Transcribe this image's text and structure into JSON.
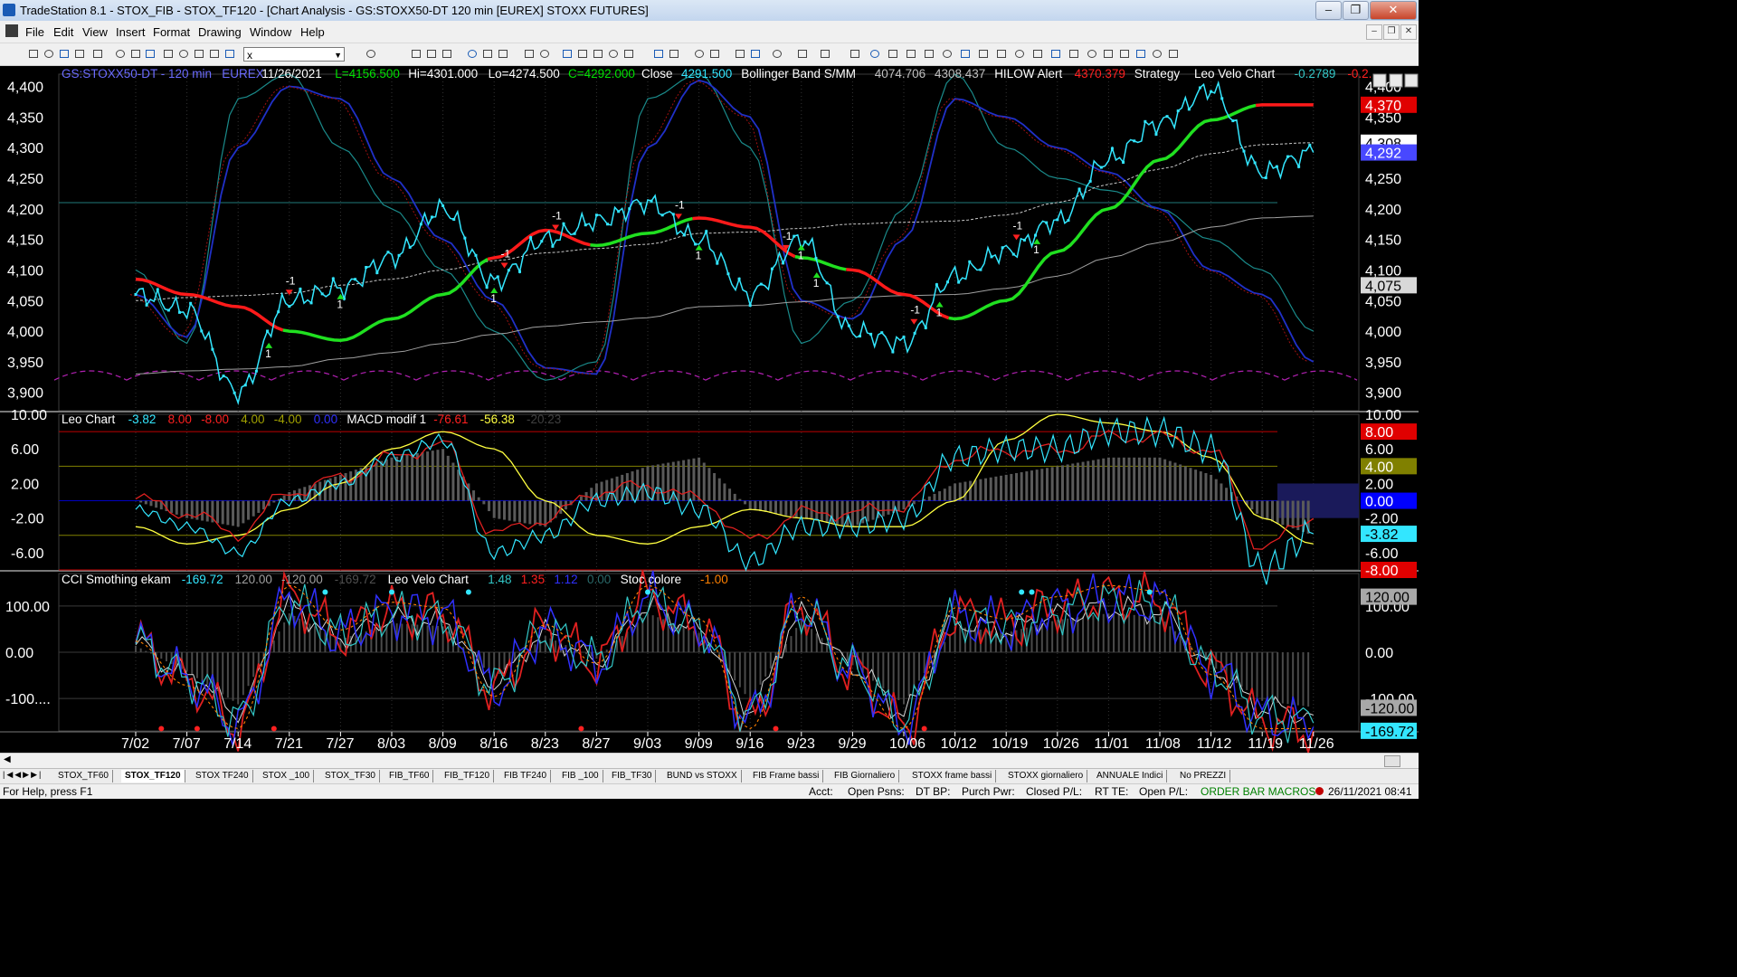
{
  "window": {
    "title": "TradeStation 8.1 - STOX_FIB - STOX_TF120 - [Chart Analysis - GS:STOXX50-DT  120 min  [EUREX] STOXX FUTURES]"
  },
  "menu": [
    "File",
    "Edit",
    "View",
    "Insert",
    "Format",
    "Drawing",
    "Window",
    "Help"
  ],
  "toolbar": {
    "symbol": "x"
  },
  "panel1": {
    "header": [
      {
        "t": "GS:STOXX50-DT - 120 min",
        "c": "#6b6bff"
      },
      {
        "t": "EUREX",
        "c": "#6b6bff"
      },
      {
        "t": "11/26/2021",
        "c": "#ffffff"
      },
      {
        "t": "L=4156.500",
        "c": "#00e000"
      },
      {
        "t": "Hi=4301.000",
        "c": "#ffffff"
      },
      {
        "t": "Lo=4274.500",
        "c": "#ffffff"
      },
      {
        "t": "C=4292.000",
        "c": "#00e000"
      },
      {
        "t": "Close",
        "c": "#ffffff"
      },
      {
        "t": "4291.500",
        "c": "#33e6ff"
      },
      {
        "t": "Bollinger Band S/MM",
        "c": "#ffffff"
      },
      {
        "t": "4074.706",
        "c": "#c0c0c0"
      },
      {
        "t": "4308.437",
        "c": "#c0c0c0"
      },
      {
        "t": "HILOW Alert",
        "c": "#ffffff"
      },
      {
        "t": "4370.379",
        "c": "#ff2020"
      },
      {
        "t": "Strategy",
        "c": "#ffffff"
      },
      {
        "t": "Leo Velo Chart",
        "c": "#ffffff"
      },
      {
        "t": "-0.2789",
        "c": "#33c8c8"
      },
      {
        "t": "-0.2...",
        "c": "#ff2020"
      }
    ],
    "ylabels": [
      "4,400",
      "4,350",
      "4,300",
      "4,250",
      "4,200",
      "4,150",
      "4,100",
      "4,050",
      "4,000",
      "3,950",
      "3,900"
    ],
    "badges": [
      {
        "t": "4,370",
        "bg": "#e00000",
        "c": "#ffffff"
      },
      {
        "t": "4,308",
        "bg": "#ffffff",
        "c": "#000000"
      },
      {
        "t": "4,292",
        "bg": "#4848ff",
        "c": "#ffffff"
      },
      {
        "t": "4,075",
        "bg": "#d8d8d8",
        "c": "#000000"
      }
    ]
  },
  "panel2": {
    "header": [
      {
        "t": "Leo Chart",
        "c": "#ffffff"
      },
      {
        "t": "-3.82",
        "c": "#33e6ff"
      },
      {
        "t": "8.00",
        "c": "#ff2020"
      },
      {
        "t": "-8.00",
        "c": "#ff2020"
      },
      {
        "t": "4.00",
        "c": "#a0a000"
      },
      {
        "t": "-4.00",
        "c": "#a0a000"
      },
      {
        "t": "0.00",
        "c": "#3030ff"
      },
      {
        "t": "MACD modif 1",
        "c": "#ffffff"
      },
      {
        "t": "-76.61",
        "c": "#ff2020"
      },
      {
        "t": "-56.38",
        "c": "#ffff40"
      },
      {
        "t": "-20.23",
        "c": "#404040"
      }
    ],
    "ylabels": [
      "10.00",
      "6.00",
      "2.00",
      "-2.00",
      "-6.00"
    ],
    "badges": [
      {
        "t": "8.00",
        "bg": "#e00000",
        "c": "#ffffff"
      },
      {
        "t": "4.00",
        "bg": "#808000",
        "c": "#ffffff"
      },
      {
        "t": "0.00",
        "bg": "#0000ff",
        "c": "#ffffff"
      },
      {
        "t": "-3.82",
        "bg": "#33e6ff",
        "c": "#000000"
      },
      {
        "t": "-8.00",
        "bg": "#e00000",
        "c": "#ffffff"
      }
    ]
  },
  "panel3": {
    "header": [
      {
        "t": "CCI Smothing ekam",
        "c": "#ffffff"
      },
      {
        "t": "-169.72",
        "c": "#33e6ff"
      },
      {
        "t": "120.00",
        "c": "#a0a0a0"
      },
      {
        "t": "-120.00",
        "c": "#a0a0a0"
      },
      {
        "t": "-169.72",
        "c": "#505050"
      },
      {
        "t": "Leo Velo Chart",
        "c": "#ffffff"
      },
      {
        "t": "1.48",
        "c": "#33c8c8"
      },
      {
        "t": "1.35",
        "c": "#ff2020"
      },
      {
        "t": "1.12",
        "c": "#3030ff"
      },
      {
        "t": "0.00",
        "c": "#2a6a6a"
      },
      {
        "t": "Stoc colore",
        "c": "#ffffff"
      },
      {
        "t": "-1.00",
        "c": "#ff8000"
      }
    ],
    "ylabels": [
      "100.00",
      "0.00",
      "-100...."
    ],
    "badges": [
      {
        "t": "120.00",
        "bg": "#a8a8a8",
        "c": "#000000"
      },
      {
        "t": "-120.00",
        "bg": "#a8a8a8",
        "c": "#000000"
      },
      {
        "t": "-169.72",
        "bg": "#33e6ff",
        "c": "#000000"
      }
    ],
    "right_labels": [
      "100.00",
      "0.00",
      "-100.00"
    ]
  },
  "xlabels": [
    "7/02",
    "7/07",
    "7/14",
    "7/21",
    "7/27",
    "8/03",
    "8/09",
    "8/16",
    "8/23",
    "8/27",
    "9/03",
    "9/09",
    "9/16",
    "9/23",
    "9/29",
    "10/06",
    "10/12",
    "10/19",
    "10/26",
    "11/01",
    "11/08",
    "11/12",
    "11/19",
    "11/26"
  ],
  "signals": [
    "-1",
    "1",
    "1",
    "-1",
    "1",
    "-1",
    "1",
    "-1",
    "-1",
    "1",
    "1",
    "-1",
    "1",
    "-1",
    "1"
  ],
  "tabs": [
    "STOX_TF60",
    "STOX_TF120",
    "STOX TF240",
    "STOX _100",
    "STOX_TF30",
    "FIB_TF60",
    "FIB_TF120",
    "FIB TF240",
    "FIB _100",
    "FIB_TF30",
    "BUND vs STOXX",
    "FIB Frame bassi",
    "FIB Giornaliero",
    "STOXX frame bassi",
    "STOXX giornaliero",
    "ANNUALE Indici",
    "No PREZZI"
  ],
  "status": {
    "help": "For Help, press F1",
    "fields": [
      "Acct:",
      "Open Psns:",
      "DT BP:",
      "Purch Pwr:",
      "Closed P/L:",
      "RT TE:",
      "Open P/L:"
    ],
    "macros": "ORDER BAR  MACROS",
    "datetime": "26/11/2021 08:41"
  },
  "colors": {
    "up": "#00e000",
    "down": "#ff2020",
    "price": "#33e6ff",
    "blue": "#2020ff",
    "gridline": "#3a3a3a"
  },
  "chart_data": [
    {
      "type": "line",
      "title": "GS:STOXX50-DT - 120 min",
      "x": [
        "7/02",
        "7/07",
        "7/14",
        "7/21",
        "7/27",
        "8/03",
        "8/09",
        "8/16",
        "8/23",
        "8/27",
        "9/03",
        "9/09",
        "9/16",
        "9/23",
        "9/29",
        "10/06",
        "10/12",
        "10/19",
        "10/26",
        "11/01",
        "11/08",
        "11/12",
        "11/19",
        "11/26"
      ],
      "ylim": [
        3870,
        4420
      ],
      "series": [
        {
          "name": "Close",
          "values": [
            4060,
            4035,
            3900,
            4050,
            4070,
            4120,
            4200,
            4080,
            4150,
            4180,
            4210,
            4150,
            4060,
            4150,
            4000,
            3980,
            4090,
            4130,
            4180,
            4280,
            4340,
            4395,
            4260,
            4292
          ]
        },
        {
          "name": "HILOW Alert",
          "values": [
            4085,
            4060,
            4040,
            4000,
            3985,
            4020,
            4060,
            4120,
            4165,
            4140,
            4160,
            4185,
            4170,
            4120,
            4100,
            4060,
            4020,
            4050,
            4130,
            4200,
            4280,
            4345,
            4370,
            4370
          ]
        },
        {
          "name": "Bollinger Band S/MM",
          "values": [
            4050,
            4055,
            4058,
            4062,
            4075,
            4085,
            4100,
            4115,
            4128,
            4135,
            4142,
            4160,
            4162,
            4168,
            4175,
            4178,
            4180,
            4190,
            4210,
            4240,
            4265,
            4290,
            4305,
            4308
          ]
        }
      ]
    },
    {
      "type": "line",
      "title": "Leo Chart",
      "x": [
        "7/02",
        "7/07",
        "7/14",
        "7/21",
        "7/27",
        "8/03",
        "8/09",
        "8/16",
        "8/23",
        "8/27",
        "9/03",
        "9/09",
        "9/16",
        "9/23",
        "9/29",
        "10/06",
        "10/12",
        "10/19",
        "10/26",
        "11/01",
        "11/08",
        "11/12",
        "11/19",
        "11/26"
      ],
      "ylim": [
        -8,
        10
      ],
      "series": [
        {
          "name": "Leo Chart",
          "values": [
            -1,
            -3,
            -6,
            0,
            2,
            5,
            7,
            -6,
            -4,
            0,
            1,
            -1,
            -7,
            -3,
            -3,
            -2,
            5,
            6,
            6,
            8,
            8,
            6,
            -8,
            -3.82
          ]
        },
        {
          "name": "MACD modif 1",
          "values": [
            -3,
            -5,
            -4,
            -1,
            2,
            6,
            8,
            6,
            0,
            -4,
            -5,
            -3,
            -1,
            -2,
            -3,
            -3,
            0,
            7,
            10,
            9,
            8,
            5,
            -2,
            -5
          ]
        }
      ]
    },
    {
      "type": "line",
      "title": "CCI Smothing ekam",
      "x": [
        "7/02",
        "7/07",
        "7/14",
        "7/21",
        "7/27",
        "8/03",
        "8/09",
        "8/16",
        "8/23",
        "8/27",
        "9/03",
        "9/09",
        "9/16",
        "9/23",
        "9/29",
        "10/06",
        "10/12",
        "10/19",
        "10/26",
        "11/01",
        "11/08",
        "11/12",
        "11/19",
        "11/26"
      ],
      "ylim": [
        -170,
        170
      ],
      "series": [
        {
          "name": "CCI Smothing ekam",
          "values": [
            20,
            -60,
            -160,
            120,
            40,
            90,
            80,
            -80,
            50,
            -20,
            120,
            60,
            -150,
            100,
            -40,
            -160,
            80,
            60,
            100,
            120,
            110,
            -40,
            -150,
            -169.72
          ]
        }
      ]
    }
  ]
}
